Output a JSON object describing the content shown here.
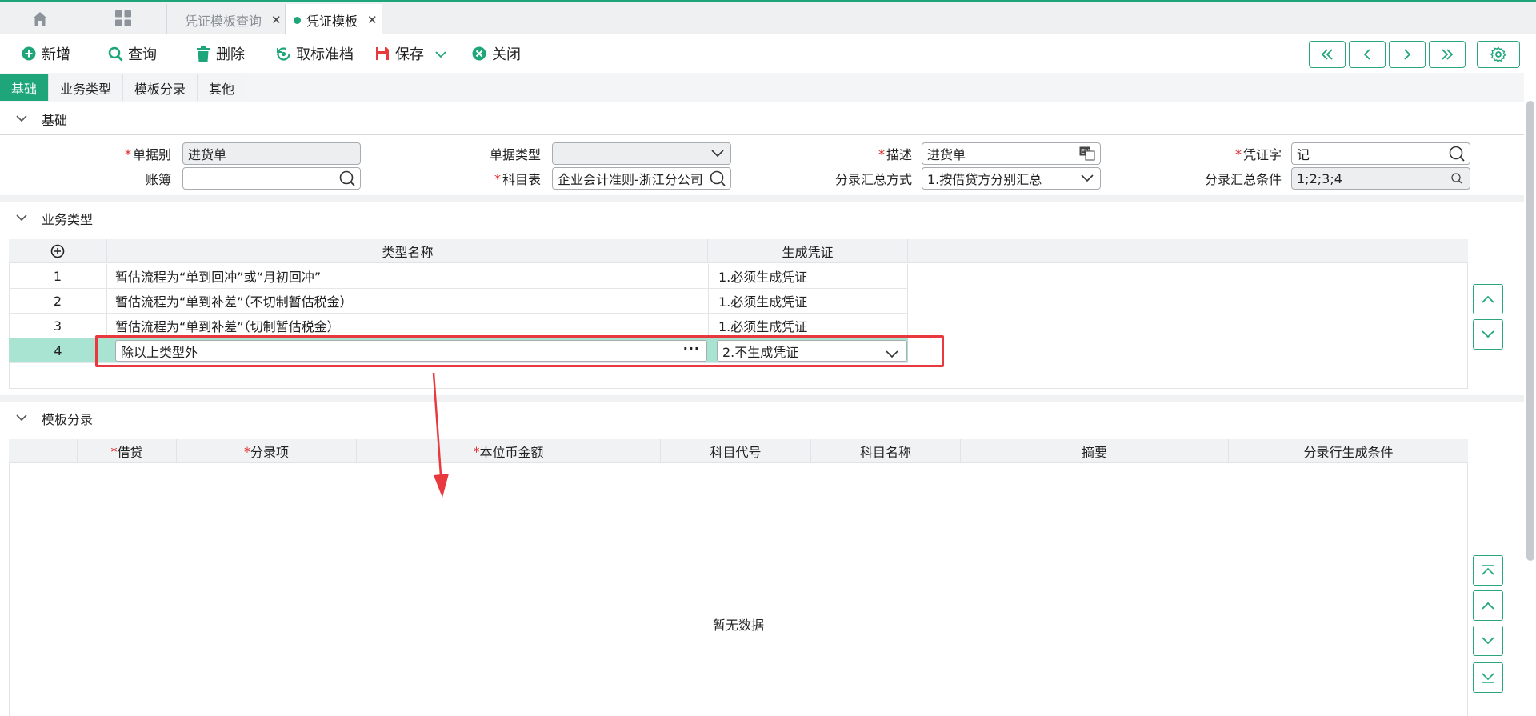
{
  "tabs": {
    "inactive_label": "凭证模板查询",
    "active_label": "凭证模板"
  },
  "toolbar": {
    "new_label": "新增",
    "query_label": "查询",
    "delete_label": "删除",
    "unarchive_label": "取标准档",
    "save_label": "保存",
    "close_label": "关闭"
  },
  "section_tabs": [
    "基础",
    "业务类型",
    "模板分录",
    "其他"
  ],
  "basic": {
    "title": "基础",
    "fields": {
      "doc_category_label": "单据别",
      "doc_category_value": "进货单",
      "doc_type_label": "单据类型",
      "doc_type_value": "",
      "desc_label": "描述",
      "desc_value": "进货单",
      "voucher_word_label": "凭证字",
      "voucher_word_value": "记",
      "ledger_label": "账簿",
      "ledger_value": "",
      "account_table_label": "科目表",
      "account_table_value": "企业会计准则-浙江分公司",
      "summary_method_label": "分录汇总方式",
      "summary_method_value": "1.按借贷方分别汇总",
      "summary_cond_label": "分录汇总条件",
      "summary_cond_value": "1;2;3;4"
    }
  },
  "business": {
    "title": "业务类型",
    "columns": [
      "类型名称",
      "生成凭证"
    ],
    "rows": [
      {
        "no": "1",
        "name": "暂估流程为“单到回冲”或“月初回冲”",
        "gen": "1.必须生成凭证"
      },
      {
        "no": "2",
        "name": "暂估流程为“单到补差”（不切制暂估税金）",
        "gen": "1.必须生成凭证"
      },
      {
        "no": "3",
        "name": "暂估流程为“单到补差”（切制暂估税金）",
        "gen": "1.必须生成凭证"
      },
      {
        "no": "4",
        "name": "除以上类型外",
        "gen": "2.不生成凭证"
      }
    ]
  },
  "entries": {
    "title": "模板分录",
    "columns": [
      "借贷",
      "分录项",
      "本位币金额",
      "科目代号",
      "科目名称",
      "摘要",
      "分录行生成条件"
    ],
    "empty_text": "暂无数据"
  },
  "colors": {
    "accent": "#1ea67a",
    "highlight_row": "#a8e4d1",
    "annotation": "#e8393f"
  }
}
